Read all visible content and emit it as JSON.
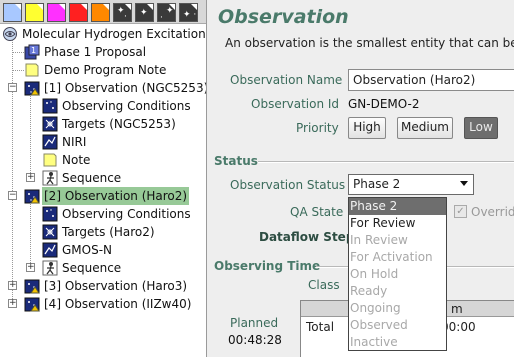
{
  "palette": {
    "swatches": [
      "#a8c8ff",
      "#ffff30",
      "#ff30ff",
      "#ff2020",
      "#ff8800",
      "#3a3a3a",
      "#3a3a3a",
      "#3a3a3a",
      "#3a3a3a"
    ],
    "accent_green": "#4a7a6a",
    "selection_green": "#97c997"
  },
  "tree": {
    "root": {
      "label": "Molecular Hydrogen Excitation",
      "icon": "program-icon"
    },
    "items": [
      {
        "label": "Phase 1 Proposal",
        "icon": "proposal-icon"
      },
      {
        "label": "Demo Program Note",
        "icon": "note-icon"
      },
      {
        "label": "[1] Observation (NGC5253)",
        "icon": "observation-icon",
        "expanded": true
      },
      {
        "label": "Observing Conditions",
        "icon": "conditions-icon"
      },
      {
        "label": "Targets (NGC5253)",
        "icon": "targets-icon"
      },
      {
        "label": "NIRI",
        "icon": "instrument-icon"
      },
      {
        "label": "Note",
        "icon": "note-icon"
      },
      {
        "label": "Sequence",
        "icon": "sequence-icon",
        "expanded": false
      },
      {
        "label": "[2] Observation (Haro2)",
        "icon": "observation-icon",
        "expanded": true,
        "selected": true
      },
      {
        "label": "Observing Conditions",
        "icon": "conditions-icon"
      },
      {
        "label": "Targets (Haro2)",
        "icon": "targets-icon"
      },
      {
        "label": "GMOS-N",
        "icon": "instrument-icon"
      },
      {
        "label": "Sequence",
        "icon": "sequence-icon",
        "expanded": false
      },
      {
        "label": "[3] Observation (Haro3)",
        "icon": "observation-icon",
        "expanded": false
      },
      {
        "label": "[4] Observation (IIZw40)",
        "icon": "observation-icon",
        "expanded": false
      }
    ]
  },
  "editor": {
    "title": "Observation",
    "description": "An observation is the smallest entity that can be sc",
    "name_label": "Observation Name",
    "name_value": "Observation (Haro2)",
    "id_label": "Observation Id",
    "id_value": "GN-DEMO-2",
    "priority_label": "Priority",
    "priority_options": [
      "High",
      "Medium",
      "Low"
    ],
    "priority_selected": "Low",
    "status_section": "Status",
    "status_label": "Observation Status",
    "status_value": "Phase 2",
    "status_options": [
      {
        "label": "Phase 2",
        "state": "selected"
      },
      {
        "label": "For Review",
        "state": "enabled"
      },
      {
        "label": "In Review",
        "state": "disabled"
      },
      {
        "label": "For Activation",
        "state": "disabled"
      },
      {
        "label": "On Hold",
        "state": "disabled"
      },
      {
        "label": "Ready",
        "state": "disabled"
      },
      {
        "label": "Ongoing",
        "state": "disabled"
      },
      {
        "label": "Observed",
        "state": "disabled"
      },
      {
        "label": "Inactive",
        "state": "disabled"
      }
    ],
    "qa_label": "QA State",
    "override_label": "Overrid",
    "override_checked": true,
    "dataflow_label": "Dataflow Step",
    "time_section": "Observing Time",
    "class_label": "Class",
    "planned_label": "Planned",
    "planned_value": "00:48:28",
    "table_header_fragment": "m",
    "table_row_label": "Total",
    "table_row_value": "00:00"
  }
}
